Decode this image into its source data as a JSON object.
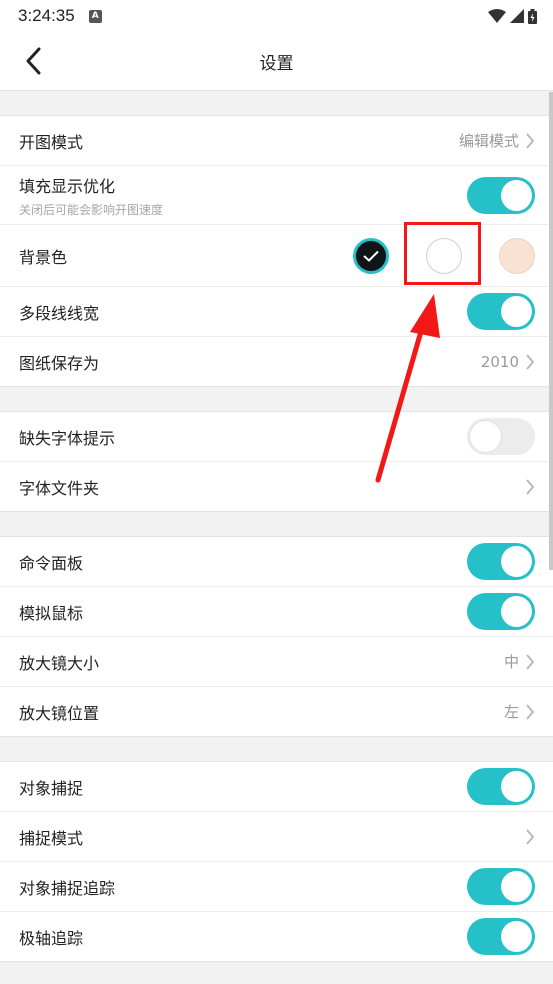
{
  "status_bar": {
    "time": "3:24:35"
  },
  "header": {
    "title": "设置"
  },
  "groups": [
    {
      "rows": [
        {
          "label": "开图模式",
          "value": "编辑模式"
        },
        {
          "label": "填充显示优化",
          "sublabel": "关闭后可能会影响开图速度",
          "toggle": true
        },
        {
          "label": "背景色",
          "selected_color": "black",
          "colors": [
            "#0f1416",
            "#ffffff",
            "#f9e2d1"
          ]
        },
        {
          "label": "多段线线宽",
          "toggle": true
        },
        {
          "label": "图纸保存为",
          "value": "2010"
        }
      ]
    },
    {
      "rows": [
        {
          "label": "缺失字体提示",
          "toggle": false
        },
        {
          "label": "字体文件夹"
        }
      ]
    },
    {
      "rows": [
        {
          "label": "命令面板",
          "toggle": true
        },
        {
          "label": "模拟鼠标",
          "toggle": true
        },
        {
          "label": "放大镜大小",
          "value": "中"
        },
        {
          "label": "放大镜位置",
          "value": "左"
        }
      ]
    },
    {
      "rows": [
        {
          "label": "对象捕捉",
          "toggle": true
        },
        {
          "label": "捕捉模式"
        },
        {
          "label": "对象捕捉追踪",
          "toggle": true
        },
        {
          "label": "极轴追踪",
          "toggle": true
        }
      ]
    }
  ],
  "colors": {
    "accent": "#26c1c8",
    "annotation": "#f21818"
  }
}
